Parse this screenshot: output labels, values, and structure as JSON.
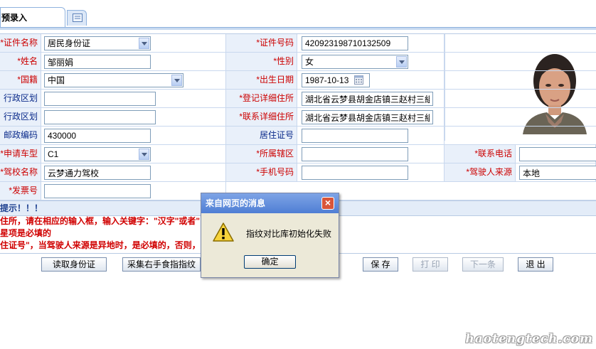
{
  "tabs": [
    {
      "label": "预录入"
    }
  ],
  "form": {
    "rows": [
      [
        {
          "label": "*证件名称",
          "value": "居民身份证",
          "type": "select"
        },
        {
          "label": "*证件号码",
          "value": "420923198710132509",
          "type": "text"
        }
      ],
      [
        {
          "label": "*姓名",
          "value": "邹丽娟",
          "type": "text"
        },
        {
          "label": "*性别",
          "value": "女",
          "type": "select"
        }
      ],
      [
        {
          "label": "*国籍",
          "value": "中国",
          "type": "select"
        },
        {
          "label": "*出生日期",
          "value": "1987-10-13",
          "type": "date"
        }
      ],
      [
        {
          "label": "行政区划",
          "value": "",
          "type": "text"
        },
        {
          "label": "*登记详细住所",
          "value": "湖北省云梦县胡金店镇三赵村三組",
          "type": "text"
        }
      ],
      [
        {
          "label": "行政区划",
          "value": "",
          "type": "text"
        },
        {
          "label": "*联系详细住所",
          "value": "湖北省云梦县胡金店镇三赵村三組",
          "type": "text"
        }
      ],
      [
        {
          "label": "邮政编码",
          "value": "430000",
          "type": "text"
        },
        {
          "label": "居住证号",
          "value": "",
          "type": "text"
        }
      ],
      [
        {
          "label": "*申请车型",
          "value": "C1",
          "type": "select"
        },
        {
          "label": "*所属辖区",
          "value": "",
          "type": "text"
        },
        {
          "label": "*联系电话",
          "value": "",
          "type": "text"
        }
      ],
      [
        {
          "label": "*驾校名称",
          "value": "云梦通力驾校",
          "type": "text"
        },
        {
          "label": "*手机号码",
          "value": "",
          "type": "text"
        },
        {
          "label": "*驾驶人来源",
          "value": "本地",
          "type": "text"
        }
      ],
      [
        {
          "label": "*发票号",
          "value": "",
          "type": "text"
        }
      ]
    ]
  },
  "notes": {
    "head": "提示！！！",
    "lines": [
      "住所，请在相应的输入框，输入关键字：\"汉字\"或者\"",
      "星项是必填的",
      "住证号\"，当驾驶人来源是异地时，是必填的，否则，"
    ]
  },
  "buttons": [
    {
      "label": "读取身份证",
      "disabled": false
    },
    {
      "label": "采集右手食指指纹",
      "disabled": false
    },
    {
      "label": "保 存",
      "disabled": false
    },
    {
      "label": "打 印",
      "disabled": true
    },
    {
      "label": "下一条",
      "disabled": true
    },
    {
      "label": "退 出",
      "disabled": false
    }
  ],
  "dialog": {
    "title": "来自网页的消息",
    "message": "指纹对比库初始化失败",
    "ok": "确定",
    "icon": "warning-icon"
  },
  "watermark": "haotengtech.com",
  "colors": {
    "label_bg": "#e9f0fa",
    "required": "#cc0000",
    "note_text": "#d00000",
    "dialog_title": "#4f7ed4"
  }
}
